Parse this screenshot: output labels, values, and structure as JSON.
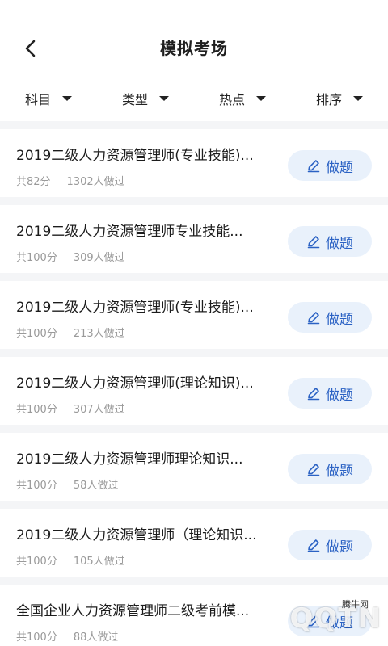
{
  "header": {
    "title": "模拟考场",
    "back_icon": "chevron-left-icon"
  },
  "filters": [
    {
      "label": "科目"
    },
    {
      "label": "类型"
    },
    {
      "label": "热点"
    },
    {
      "label": "排序"
    }
  ],
  "button": {
    "label": "做题",
    "icon": "pencil-icon",
    "accent": "#2b62c4",
    "bg": "#e9f1fb"
  },
  "items": [
    {
      "title": "2019二级人力资源管理师(专业技能)...",
      "score": "共82分",
      "count": "1302人做过"
    },
    {
      "title": "2019二级人力资源管理师专业技能...",
      "score": "共100分",
      "count": "309人做过"
    },
    {
      "title": "2019二级人力资源管理师(专业技能)...",
      "score": "共100分",
      "count": "213人做过"
    },
    {
      "title": "2019二级人力资源管理师(理论知识)...",
      "score": "共100分",
      "count": "307人做过"
    },
    {
      "title": "2019二级人力资源管理师理论知识...",
      "score": "共100分",
      "count": "58人做过"
    },
    {
      "title": "2019二级人力资源管理师（理论知识...",
      "score": "共100分",
      "count": "105人做过"
    },
    {
      "title": "全国企业人力资源管理师二级考前模...",
      "score": "共100分",
      "count": "88人做过"
    }
  ],
  "watermark": {
    "logo": "QQTN",
    "text": "腾牛网"
  }
}
